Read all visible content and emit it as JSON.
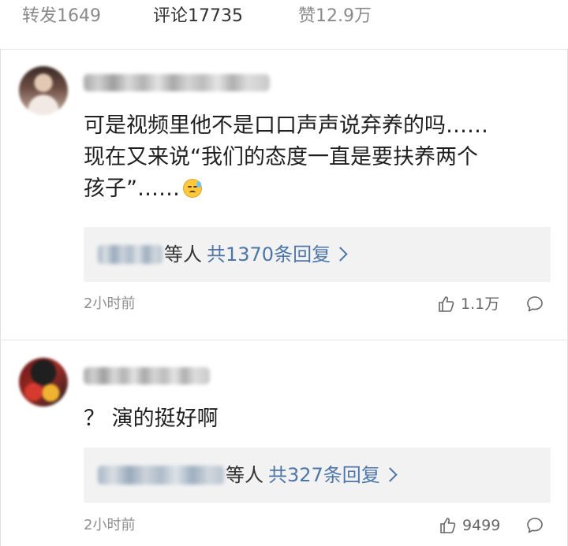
{
  "tabs": {
    "repost": "转发1649",
    "comments": "评论17735",
    "likes": "赞12.9万"
  },
  "accent_color": "#ff8200",
  "link_color": "#4d76a8",
  "comments": [
    {
      "avatar_icon": "blurred-avatar",
      "text_lines": [
        "可是视频里他不是口口声声说弃养的吗……",
        "现在又来说“我们的态度一直是要扶养两个",
        "孩子”……"
      ],
      "emoji": "sweat-face-icon",
      "reply_suffix": "等人",
      "reply_count": "共1370条回复",
      "time": "2小时前",
      "likes": "1.1万"
    },
    {
      "avatar_icon": "blurred-avatar",
      "text_lines": [
        "？ 演的挺好啊"
      ],
      "reply_suffix": "等人",
      "reply_count": "共327条回复",
      "time": "2小时前",
      "likes": "9499"
    }
  ]
}
